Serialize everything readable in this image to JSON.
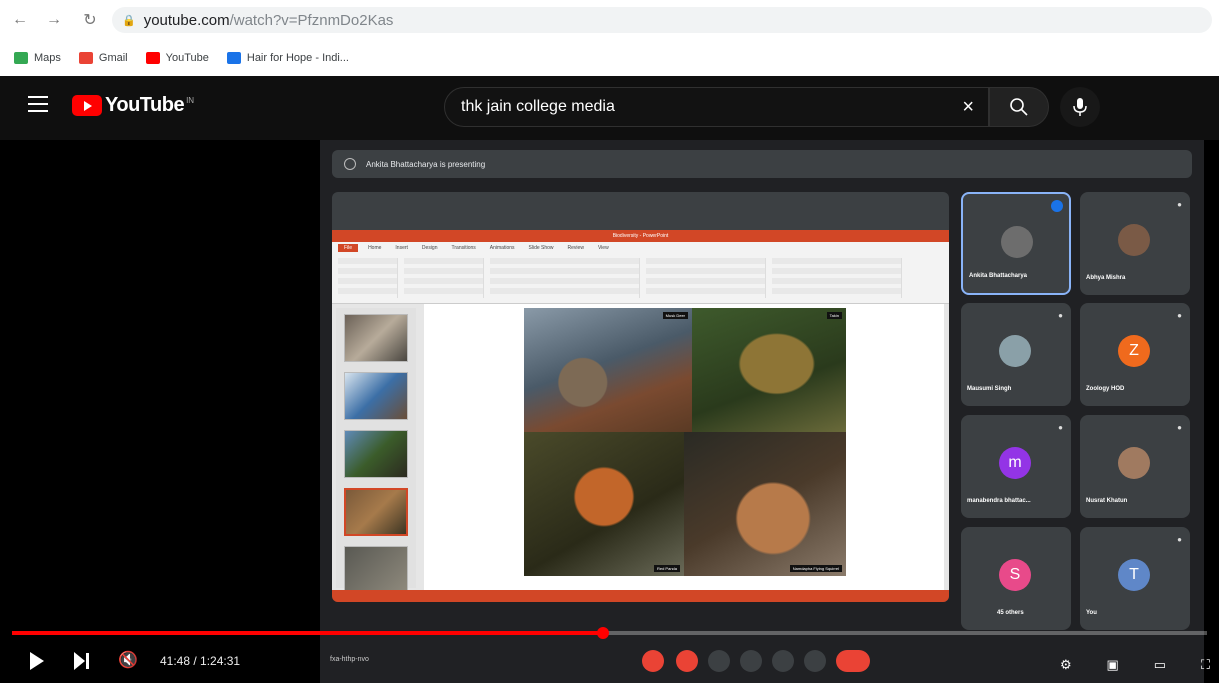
{
  "browser": {
    "url_domain": "youtube.com",
    "url_path": "/watch?v=PfznmDo2Kas",
    "bookmarks": [
      {
        "label": "Maps",
        "color": "#34a853"
      },
      {
        "label": "Gmail",
        "color": "#ea4335"
      },
      {
        "label": "YouTube",
        "color": "#ff0000"
      },
      {
        "label": "Hair for Hope - Indi...",
        "color": "#1a73e8"
      }
    ]
  },
  "youtube": {
    "logo_text": "YouTube",
    "country_code": "IN",
    "search_value": "thk jain college media"
  },
  "meet": {
    "presenting_text": "Ankita Bhattacharya is presenting",
    "ppt_title": "Biodiversity - PowerPoint",
    "ppt_tabs": [
      "File",
      "Home",
      "Insert",
      "Design",
      "Transitions",
      "Animations",
      "Slide Show",
      "Review",
      "View"
    ],
    "photo_labels": [
      "Musk Deer",
      "Takin",
      "Red Panda",
      "Namdapha Flying Squirrel"
    ],
    "participants": [
      {
        "name": "Ankita Bhattacharya",
        "initial": "",
        "color": "#6d6d6d"
      },
      {
        "name": "Abhya Mishra",
        "initial": "",
        "color": "#7a5a46"
      },
      {
        "name": "Mausumi Singh",
        "initial": "",
        "color": "#8aa0a8"
      },
      {
        "name": "Zoology HOD",
        "initial": "Z",
        "color": "#f06a1d"
      },
      {
        "name": "manabendra bhattac...",
        "initial": "m",
        "color": "#9334e6"
      },
      {
        "name": "Nusrat Khatun",
        "initial": "",
        "color": "#a07a60"
      },
      {
        "name": "45 others",
        "initial": "S",
        "color": "#e84a8a"
      },
      {
        "name": "You",
        "initial": "T",
        "color": "#5f87c8"
      }
    ],
    "meeting_code": "fxa-hthp-nvo"
  },
  "player": {
    "time": "41:48 / 1:24:31",
    "progress": 0.4945
  }
}
